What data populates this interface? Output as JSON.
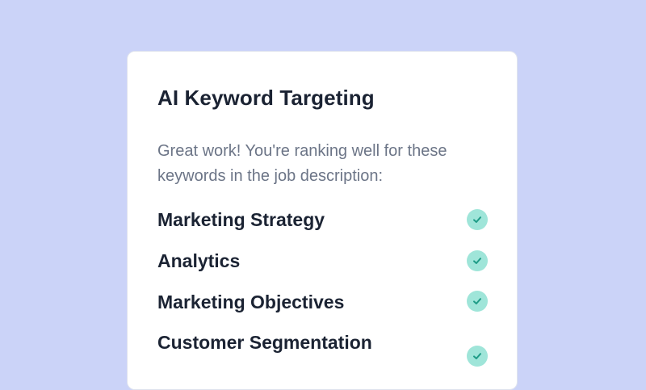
{
  "card": {
    "title": "AI Keyword Targeting",
    "description": "Great work! You're ranking well for these keywords in the job description:"
  },
  "keywords": [
    {
      "label": "Marketing Strategy",
      "status": "matched",
      "icon": "check-circle-icon"
    },
    {
      "label": "Analytics",
      "status": "matched",
      "icon": "check-circle-icon"
    },
    {
      "label": "Marketing Objectives",
      "status": "matched",
      "icon": "check-circle-icon"
    },
    {
      "label": "Customer Segmentation",
      "status": "matched",
      "icon": "check-circle-icon"
    }
  ],
  "colors": {
    "background": "#cbd3f8",
    "card": "#ffffff",
    "text_primary": "#1b2333",
    "text_secondary": "#6c7587",
    "check_bg": "#9fe5d9",
    "check_mark": "#1f9c87"
  }
}
